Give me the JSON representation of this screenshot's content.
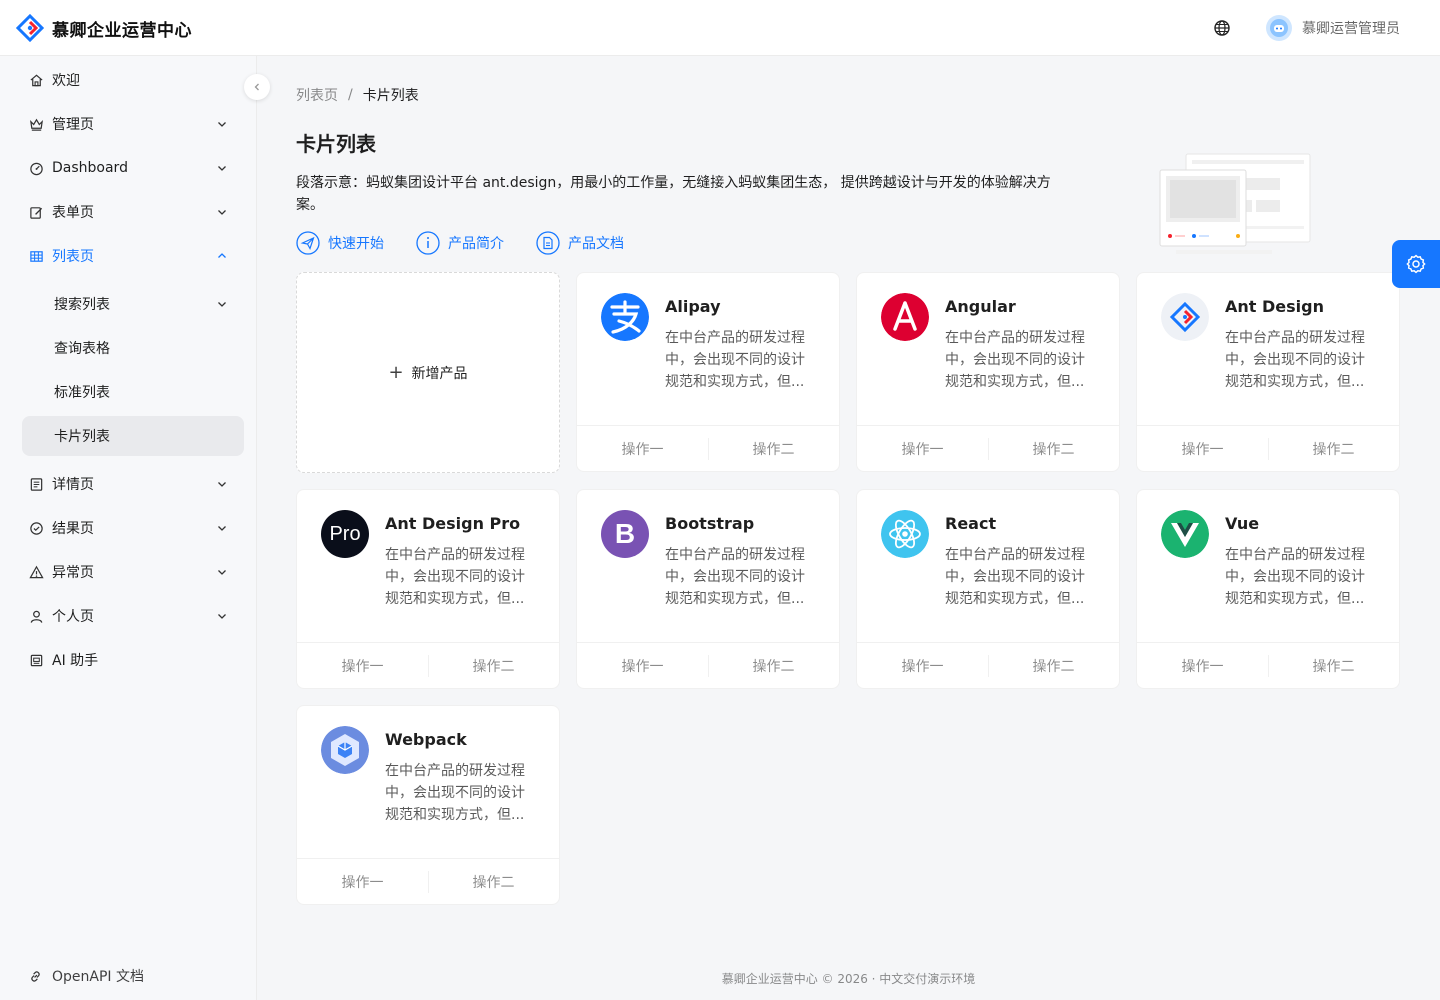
{
  "header": {
    "app_title": "慕卿企业运营中心",
    "user_name": "慕卿运营管理员"
  },
  "sidebar": {
    "items": [
      {
        "label": "欢迎"
      },
      {
        "label": "管理页"
      },
      {
        "label": "Dashboard"
      },
      {
        "label": "表单页"
      },
      {
        "label": "列表页"
      },
      {
        "label": "搜索列表"
      },
      {
        "label": "查询表格"
      },
      {
        "label": "标准列表"
      },
      {
        "label": "卡片列表"
      },
      {
        "label": "详情页"
      },
      {
        "label": "结果页"
      },
      {
        "label": "异常页"
      },
      {
        "label": "个人页"
      },
      {
        "label": "AI 助手"
      }
    ],
    "openapi_label": "OpenAPI 文档"
  },
  "breadcrumb": {
    "parent": "列表页",
    "separator": "/",
    "current": "卡片列表"
  },
  "page": {
    "title": "卡片列表",
    "description": "段落示意：蚂蚁集团设计平台 ant.design，用最小的工作量，无缝接入蚂蚁集团生态， 提供跨越设计与开发的体验解决方案。",
    "links": [
      {
        "label": "快速开始",
        "icon": "paper-plane-icon"
      },
      {
        "label": "产品简介",
        "icon": "info-icon"
      },
      {
        "label": "产品文档",
        "icon": "document-icon"
      }
    ]
  },
  "new_product_label": "新增产品",
  "cards": [
    {
      "title": "Alipay",
      "desc": "在中台产品的研发过程中，会出现不同的设计规范和实现方式，但...",
      "action1": "操作一",
      "action2": "操作二",
      "color": "#1677ff"
    },
    {
      "title": "Angular",
      "desc": "在中台产品的研发过程中，会出现不同的设计规范和实现方式，但...",
      "action1": "操作一",
      "action2": "操作二",
      "color": "#dd0031"
    },
    {
      "title": "Ant Design",
      "desc": "在中台产品的研发过程中，会出现不同的设计规范和实现方式，但...",
      "action1": "操作一",
      "action2": "操作二",
      "color": "#eef1f6"
    },
    {
      "title": "Ant Design Pro",
      "avatar_text": "Pro",
      "desc": "在中台产品的研发过程中，会出现不同的设计规范和实现方式，但...",
      "action1": "操作一",
      "action2": "操作二",
      "color": "#0a0e1a"
    },
    {
      "title": "Bootstrap",
      "avatar_text": "B",
      "desc": "在中台产品的研发过程中，会出现不同的设计规范和实现方式，但...",
      "action1": "操作一",
      "action2": "操作二",
      "color": "#7952b3"
    },
    {
      "title": "React",
      "desc": "在中台产品的研发过程中，会出现不同的设计规范和实现方式，但...",
      "action1": "操作一",
      "action2": "操作二",
      "color": "#3fc4ef"
    },
    {
      "title": "Vue",
      "desc": "在中台产品的研发过程中，会出现不同的设计规范和实现方式，但...",
      "action1": "操作一",
      "action2": "操作二",
      "color": "#1bb370"
    },
    {
      "title": "Webpack",
      "desc": "在中台产品的研发过程中，会出现不同的设计规范和实现方式，但...",
      "action1": "操作一",
      "action2": "操作二",
      "color": "#6b8ce0"
    }
  ],
  "footer": "慕卿企业运营中心 © 2026 · 中文交付演示环境",
  "colors": {
    "primary": "#1677ff"
  }
}
